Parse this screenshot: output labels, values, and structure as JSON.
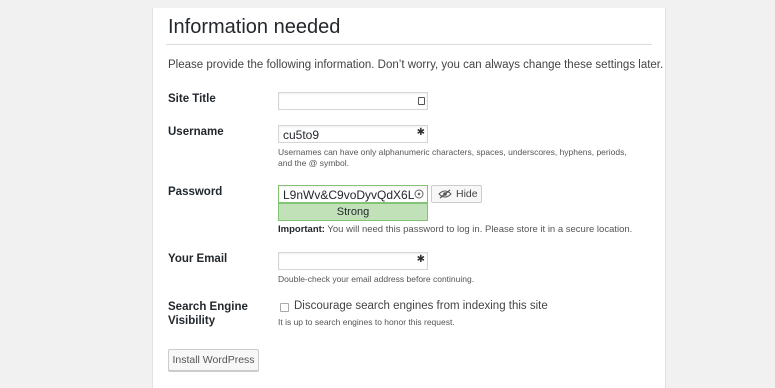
{
  "heading": "Information needed",
  "intro": "Please provide the following information. Don’t worry, you can always change these settings later.",
  "site_title": {
    "label": "Site Title",
    "value": ""
  },
  "username": {
    "label": "Username",
    "value": "cu5to9",
    "help": "Usernames can have only alphanumeric characters, spaces, underscores, hyphens, periods, and the @ symbol."
  },
  "password": {
    "label": "Password",
    "value": "L9nWv&C9voDyvQdX6L",
    "strength": "Strong",
    "hide_label": "Hide",
    "note_bold": "Important:",
    "note": " You will need this password to log in. Please store it in a secure location."
  },
  "email": {
    "label": "Your Email",
    "value": "",
    "help": "Double-check your email address before continuing."
  },
  "search_visibility": {
    "label_line1": "Search Engine",
    "label_line2": "Visibility",
    "checkbox_label": "Discourage search engines from indexing this site",
    "checked": false,
    "help": "It is up to search engines to honor this request."
  },
  "install_button": "Install WordPress",
  "colors": {
    "strength_bg": "#c1e1b9",
    "strength_border": "#83c373",
    "heading": "#23282d"
  }
}
